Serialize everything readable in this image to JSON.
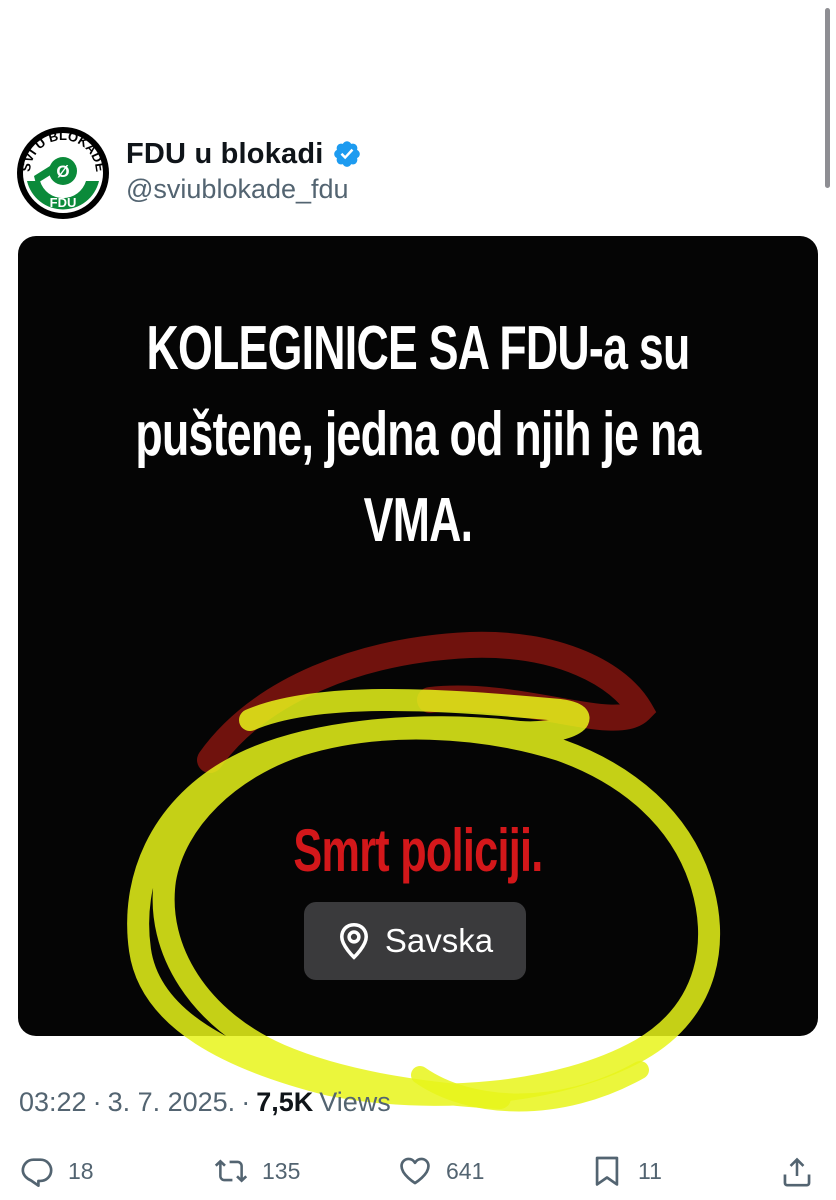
{
  "tweet": {
    "display_name": "FDU u blokadi",
    "handle": "@sviublokade_fdu",
    "avatar": {
      "top_text": "SVI U BLOKADE",
      "bottom_text": "FDU",
      "colors": {
        "ring": "#0b8a3a",
        "center": "#ffffff",
        "border": "#000000"
      }
    },
    "verified_icon": "verified-badge-icon",
    "verified_color": "#1d9bf0"
  },
  "media": {
    "headline_lines": [
      "KOLEGINICE SA FDU-a su",
      "puštene, jedna od njih je na",
      "VMA."
    ],
    "red_text": "Smrt policiji.",
    "red_color": "#d3171a",
    "location": {
      "icon": "location-pin-icon",
      "label": "Savska"
    },
    "scribble_color": "#e8f51a"
  },
  "meta": {
    "time": "03:22",
    "sep1": "·",
    "date": "3. 7. 2025.",
    "sep2": "·",
    "views_count": "7,5K",
    "views_label": "Views"
  },
  "actions": {
    "replies": "18",
    "reposts": "135",
    "likes": "641",
    "bookmarks": "11"
  },
  "colors": {
    "text": "#0f1419",
    "muted": "#536471"
  }
}
